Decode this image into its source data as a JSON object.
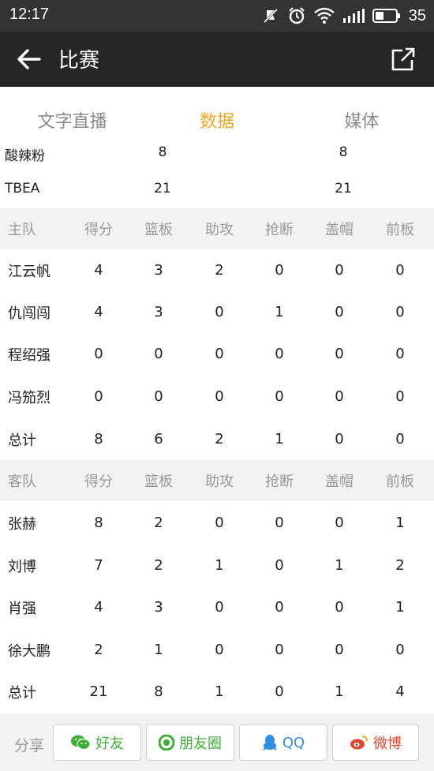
{
  "status_bar": {
    "time": "12:17",
    "battery": "35"
  },
  "app_bar": {
    "title": "比赛"
  },
  "tabs": [
    {
      "label": "文字直播",
      "active": false
    },
    {
      "label": "数据",
      "active": true
    },
    {
      "label": "媒体",
      "active": false
    }
  ],
  "scores": [
    {
      "team": "酸辣粉",
      "v1": "8",
      "v2": "8"
    },
    {
      "team": "TBEA",
      "v1": "21",
      "v2": "21"
    }
  ],
  "home": {
    "headers": [
      "主队",
      "得分",
      "篮板",
      "助攻",
      "抢断",
      "盖帽",
      "前板"
    ],
    "rows": [
      [
        "江云帆",
        "4",
        "3",
        "2",
        "0",
        "0",
        "0"
      ],
      [
        "仇闯闯",
        "4",
        "3",
        "0",
        "1",
        "0",
        "0"
      ],
      [
        "程绍强",
        "0",
        "0",
        "0",
        "0",
        "0",
        "0"
      ],
      [
        "冯笳烈",
        "0",
        "0",
        "0",
        "0",
        "0",
        "0"
      ],
      [
        "总计",
        "8",
        "6",
        "2",
        "1",
        "0",
        "0"
      ]
    ]
  },
  "away": {
    "headers": [
      "客队",
      "得分",
      "篮板",
      "助攻",
      "抢断",
      "盖帽",
      "前板"
    ],
    "rows": [
      [
        "张赫",
        "8",
        "2",
        "0",
        "0",
        "0",
        "1"
      ],
      [
        "刘博",
        "7",
        "2",
        "1",
        "0",
        "1",
        "2"
      ],
      [
        "肖强",
        "4",
        "3",
        "0",
        "0",
        "0",
        "1"
      ],
      [
        "徐大鹏",
        "2",
        "1",
        "0",
        "0",
        "0",
        "0"
      ],
      [
        "总计",
        "21",
        "8",
        "1",
        "0",
        "1",
        "4"
      ]
    ]
  },
  "share": {
    "label": "分享",
    "friends": "好友",
    "moments": "朋友圈",
    "qq": "QQ",
    "weibo": "微博"
  },
  "colors": {
    "accent": "#f0a724",
    "appbar": "#262626",
    "statusbar": "#333333",
    "wechat": "#3cb034",
    "qq": "#2f8ee6",
    "weibo": "#e3462f"
  }
}
